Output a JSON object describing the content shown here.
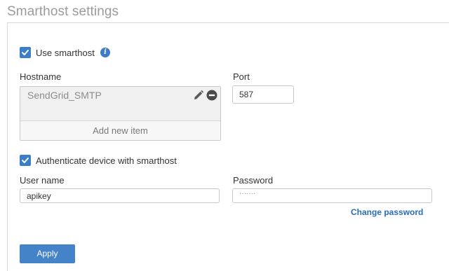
{
  "section": {
    "title": "Smarthost settings"
  },
  "use_smarthost": {
    "label": "Use smarthost",
    "checked": true
  },
  "hostname": {
    "label": "Hostname",
    "items": [
      "SendGrid_SMTP"
    ],
    "add_label": "Add new item"
  },
  "port": {
    "label": "Port",
    "value": "587"
  },
  "authenticate": {
    "label": "Authenticate device with smarthost",
    "checked": true
  },
  "username": {
    "label": "User name",
    "value": "apikey"
  },
  "password": {
    "label": "Password",
    "masked": "·······"
  },
  "links": {
    "change_password": "Change password"
  },
  "buttons": {
    "apply": "Apply"
  },
  "colors": {
    "accent": "#3b7dc6",
    "button": "#4583c9",
    "link": "#2a6db5"
  }
}
